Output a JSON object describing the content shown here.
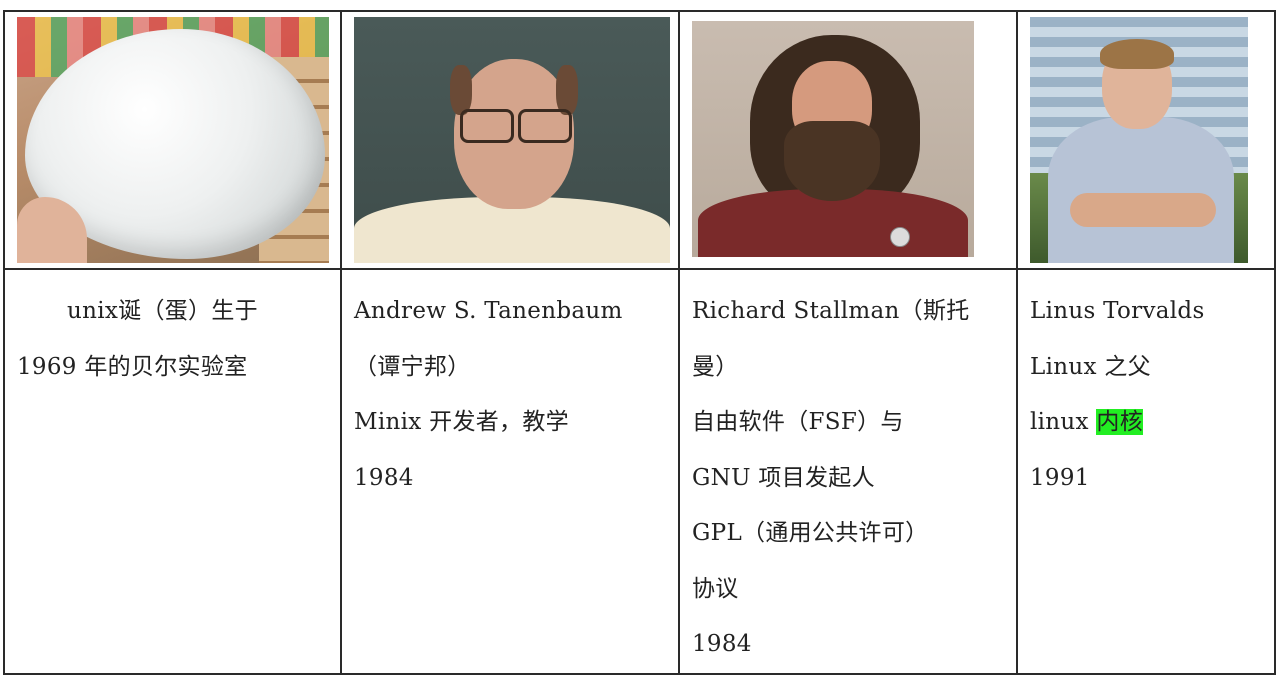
{
  "columns": [
    {
      "photo": "egg-photo",
      "lines": [
        "unix诞（蛋）生于",
        "1969 年的贝尔实验室"
      ]
    },
    {
      "photo": "tanenbaum-portrait",
      "lines": [
        "Andrew S. Tanenbaum",
        "（谭宁邦）",
        "Minix 开发者，教学",
        "1984"
      ]
    },
    {
      "photo": "stallman-portrait",
      "lines": [
        "Richard Stallman（斯托",
        "曼）",
        "自由软件（FSF）与",
        "GNU 项目发起人",
        "GPL（通用公共许可）",
        "协议",
        "1984"
      ]
    },
    {
      "photo": "torvalds-portrait",
      "lines": [
        "Linus Torvalds",
        "Linux 之父",
        "1991"
      ],
      "kernel_line": {
        "prefix": "linux ",
        "highlight": "内核"
      }
    }
  ],
  "colors": {
    "border": "#2a2a2a",
    "highlight": "#22ee22",
    "text": "#222222"
  }
}
